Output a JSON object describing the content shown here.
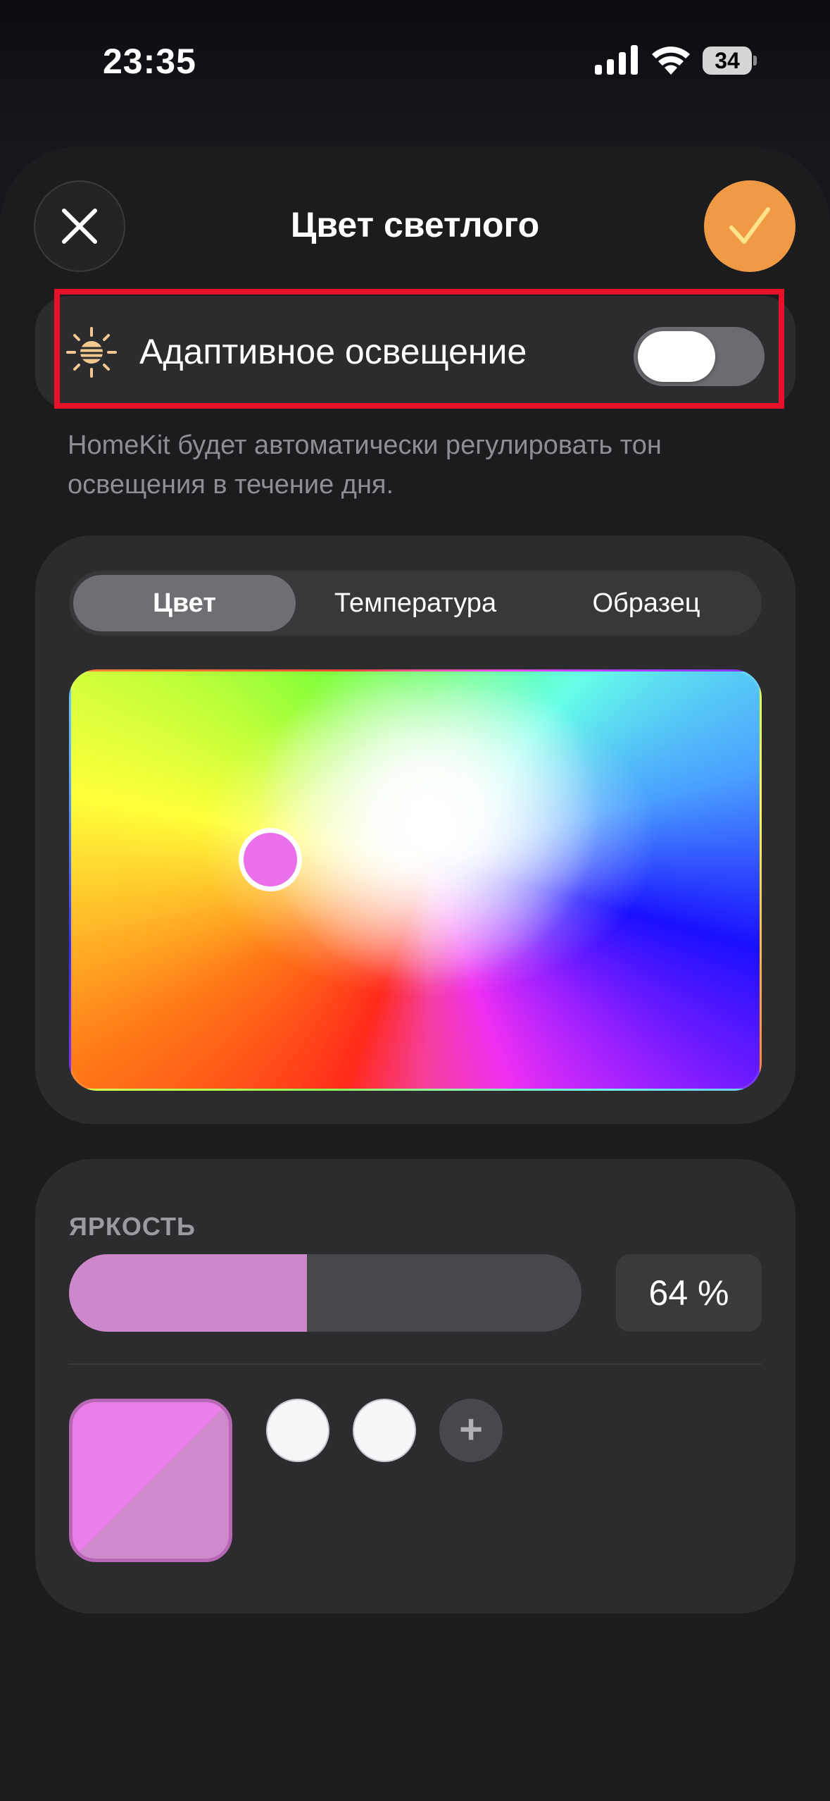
{
  "status_bar": {
    "time": "23:35",
    "battery": "34"
  },
  "sheet": {
    "title": "Цвет светлого"
  },
  "adaptive": {
    "label": "Адаптивное освещение",
    "enabled": false,
    "note": "HomeKit будет автоматически регулировать тон освещения в течение дня."
  },
  "color_picker": {
    "tabs": [
      {
        "label": "Цвет",
        "active": true
      },
      {
        "label": "Температура",
        "active": false
      },
      {
        "label": "Образец",
        "active": false
      }
    ],
    "selected_color": "#ea6fe8"
  },
  "brightness": {
    "label": "ЯРКОСТЬ",
    "value_text": "64 %",
    "value": 0.64,
    "fill_color": "#cd88cc"
  },
  "swatches": {
    "current_color": "#ec7eea",
    "presets": [
      "#f7f6f8",
      "#f7f6f8"
    ],
    "add_label": "+"
  },
  "colors": {
    "accent": "#f09a45",
    "highlight": "#e8112a"
  }
}
